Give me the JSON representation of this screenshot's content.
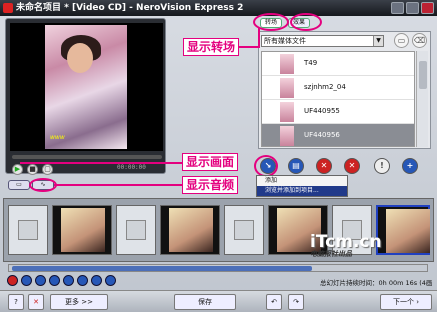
{
  "window": {
    "title": "未命名项目 * [Video CD] - NeroVision Express 2"
  },
  "preview": {
    "timecode": "00:00:00"
  },
  "panel": {
    "tabs": [
      "转场",
      "效果"
    ],
    "dropdown": "所有媒体文件",
    "items": [
      "T49",
      "szjnhm2_04",
      "UF440955",
      "UF440956"
    ]
  },
  "context_menu": {
    "items": [
      "添加",
      "浏览并添加到项目..."
    ]
  },
  "annotations": {
    "transitions": "显示转场",
    "picture": "显示画面",
    "audio": "显示音频"
  },
  "logo": {
    "main": "iTcm.cn",
    "sub": "电脑报社出品"
  },
  "timeline": {
    "duration_label": "总幻灯片持续时间：0h 00m 16s (4画面)"
  },
  "bottom": {
    "more": "更多 >>",
    "save": "保存",
    "next": "下一个"
  },
  "colors": {
    "annotation": "#e4007f",
    "accent": "#2657b7"
  }
}
